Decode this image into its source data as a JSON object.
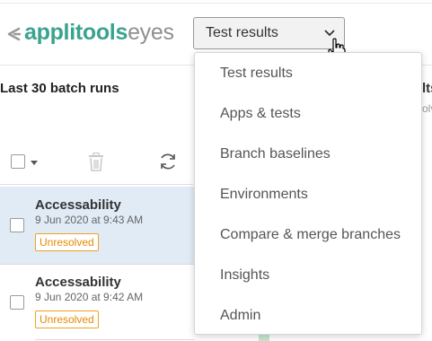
{
  "header": {
    "logo_strong": "applitools",
    "logo_light": "eyes",
    "selector_value": "Test results"
  },
  "panel": {
    "title": "Last 30 batch runs",
    "right_peek_title": "lts",
    "right_peek_sub": "olv"
  },
  "batches": [
    {
      "name": "Accessability",
      "date": "9 Jun 2020 at 9:43 AM",
      "status": "Unresolved"
    },
    {
      "name": "Accessability",
      "date": "9 Jun 2020 at 9:42 AM",
      "status": "Unresolved"
    }
  ],
  "menu": {
    "items": [
      "Test results",
      "Apps & tests",
      "Branch baselines",
      "Environments",
      "Compare & merge branches",
      "Insights",
      "Admin"
    ]
  },
  "colors": {
    "brand": "#3aa38f",
    "selected_row": "#e0ebf6",
    "status_unresolved": "#e58a00"
  },
  "icons": [
    "applitools-logo-icon",
    "chevron-down-icon",
    "hand-cursor-icon",
    "caret-down-icon",
    "trash-icon",
    "refresh-icon"
  ]
}
